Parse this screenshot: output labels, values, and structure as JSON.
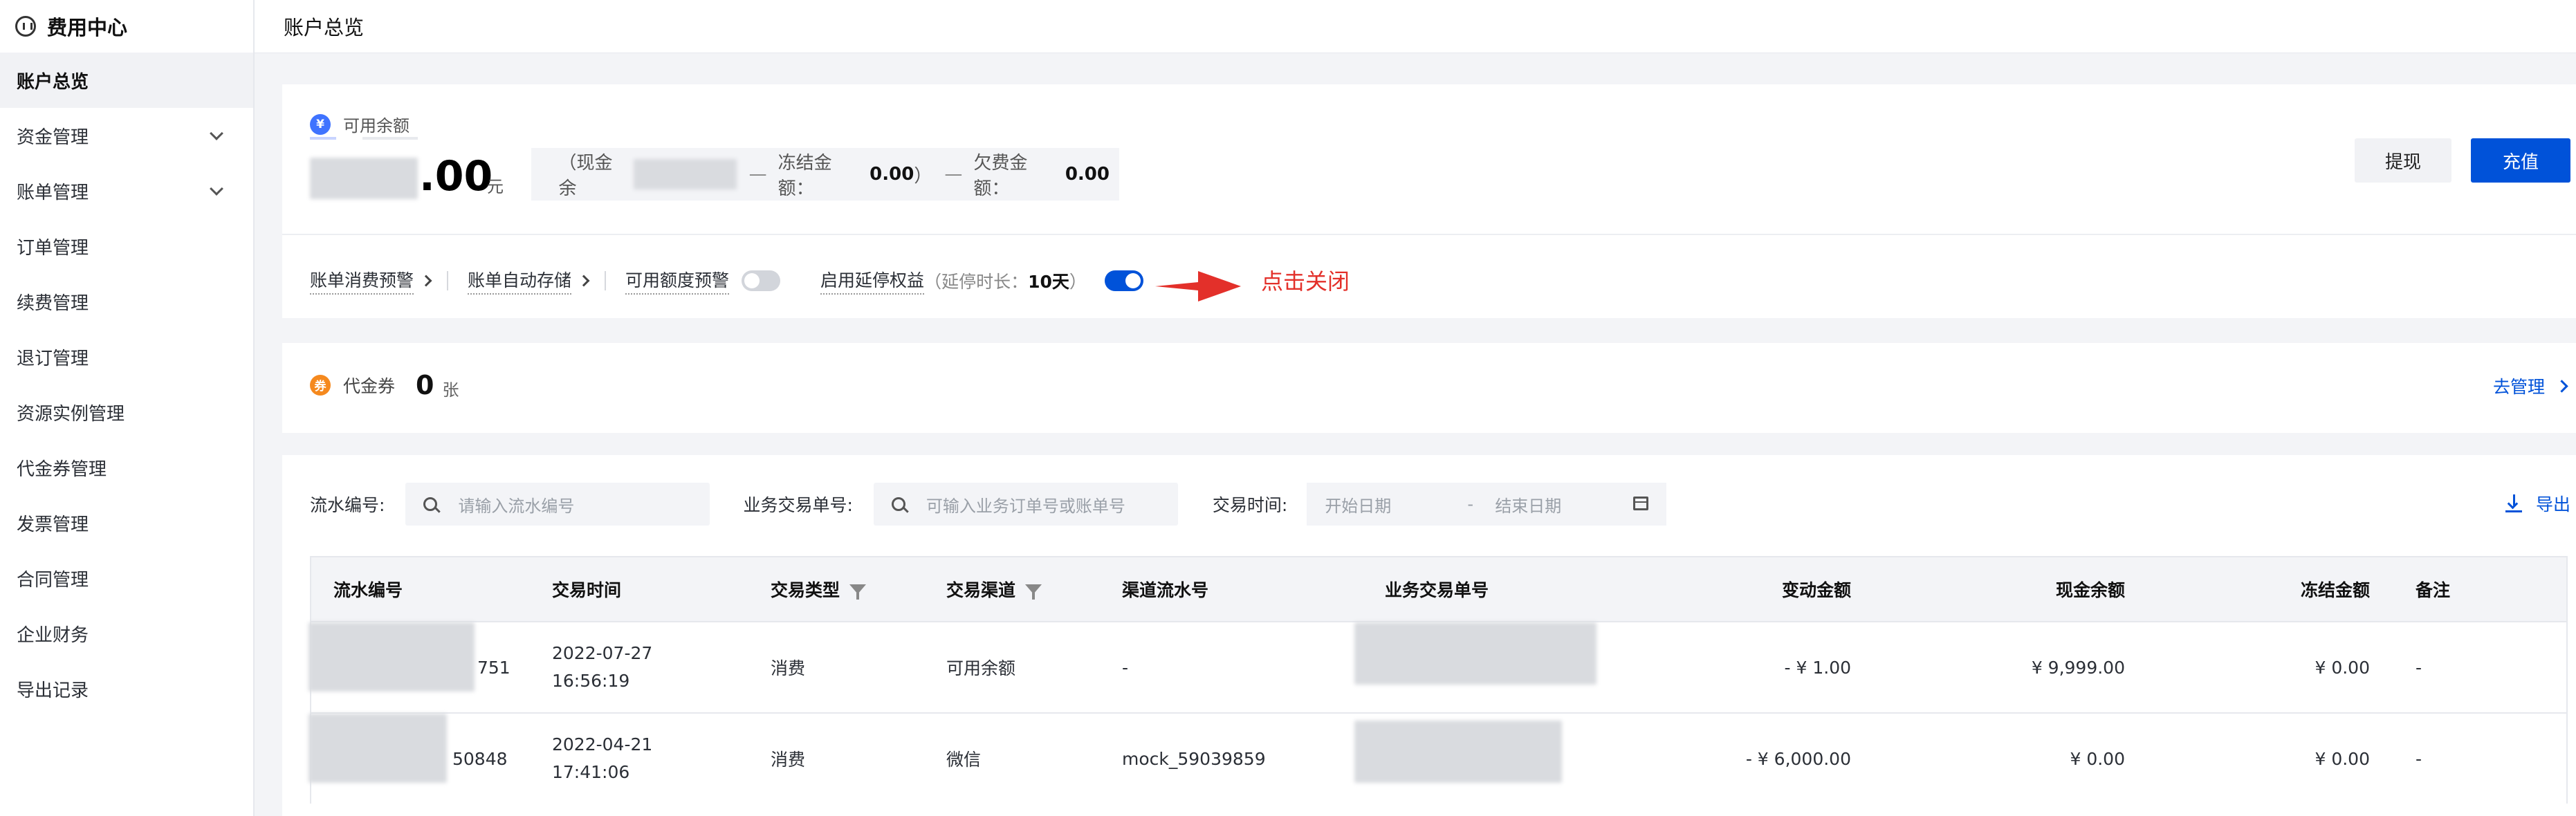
{
  "sidebar": {
    "title": "费用中心",
    "items": [
      {
        "label": "账户总览",
        "active": true
      },
      {
        "label": "资金管理",
        "expandable": true
      },
      {
        "label": "账单管理",
        "expandable": true
      },
      {
        "label": "订单管理"
      },
      {
        "label": "续费管理"
      },
      {
        "label": "退订管理"
      },
      {
        "label": "资源实例管理"
      },
      {
        "label": "代金券管理"
      },
      {
        "label": "发票管理"
      },
      {
        "label": "合同管理"
      },
      {
        "label": "企业财务"
      },
      {
        "label": "导出记录"
      }
    ]
  },
  "header": {
    "title": "账户总览"
  },
  "balance": {
    "label": "可用余额",
    "amount_suffix": ".00",
    "unit": "元",
    "cash_label": "（现金余",
    "frozen_label": "冻结金额：",
    "frozen_value": "0.00",
    "frozen_close": "）",
    "owed_label": "欠费金额：",
    "owed_value": "0.00",
    "withdraw_label": "提现",
    "recharge_label": "充值"
  },
  "options": {
    "bill_alert": "账单消费预警",
    "bill_storage": "账单自动存储",
    "quota_alert": "可用额度预警",
    "quota_alert_on": false,
    "suspend_label": "启用延停权益",
    "suspend_hint_prefix": "（延停时长：",
    "suspend_hint_value": "10天",
    "suspend_hint_suffix": "）",
    "suspend_on": true,
    "annotation": "点击关闭"
  },
  "coupon": {
    "label": "代金券",
    "count": "0",
    "unit": "张",
    "manage_label": "去管理"
  },
  "filters": {
    "serial_label": "流水编号:",
    "serial_placeholder": "请输入流水编号",
    "biz_label": "业务交易单号:",
    "biz_placeholder": "可输入业务订单号或账单号",
    "time_label": "交易时间:",
    "start_placeholder": "开始日期",
    "range_sep": "-",
    "end_placeholder": "结束日期",
    "export_label": "导出"
  },
  "table": {
    "columns": [
      "流水编号",
      "交易时间",
      "交易类型",
      "交易渠道",
      "渠道流水号",
      "业务交易单号",
      "变动金额",
      "现金余额",
      "冻结金额",
      "备注"
    ],
    "rows": [
      {
        "serial": "751",
        "time_date": "2022-07-27",
        "time_clock": "16:56:19",
        "type": "消费",
        "channel": "可用余额",
        "channel_serial": "-",
        "biz_no": "",
        "change": "- ¥ 1.00",
        "cash": "¥ 9,999.00",
        "frozen": "¥ 0.00",
        "note": "-"
      },
      {
        "serial": "50848",
        "time_date": "2022-04-21",
        "time_clock": "17:41:06",
        "type": "消费",
        "channel": "微信",
        "channel_serial": "mock_59039859",
        "biz_no": "",
        "change": "- ¥ 6,000.00",
        "cash": "¥ 0.00",
        "frozen": "¥ 0.00",
        "note": "-"
      }
    ]
  },
  "colors": {
    "primary": "#0052d9",
    "annotation": "#e3302a",
    "coupon_icon": "#f5891e",
    "balance_icon": "#3f73ff"
  }
}
